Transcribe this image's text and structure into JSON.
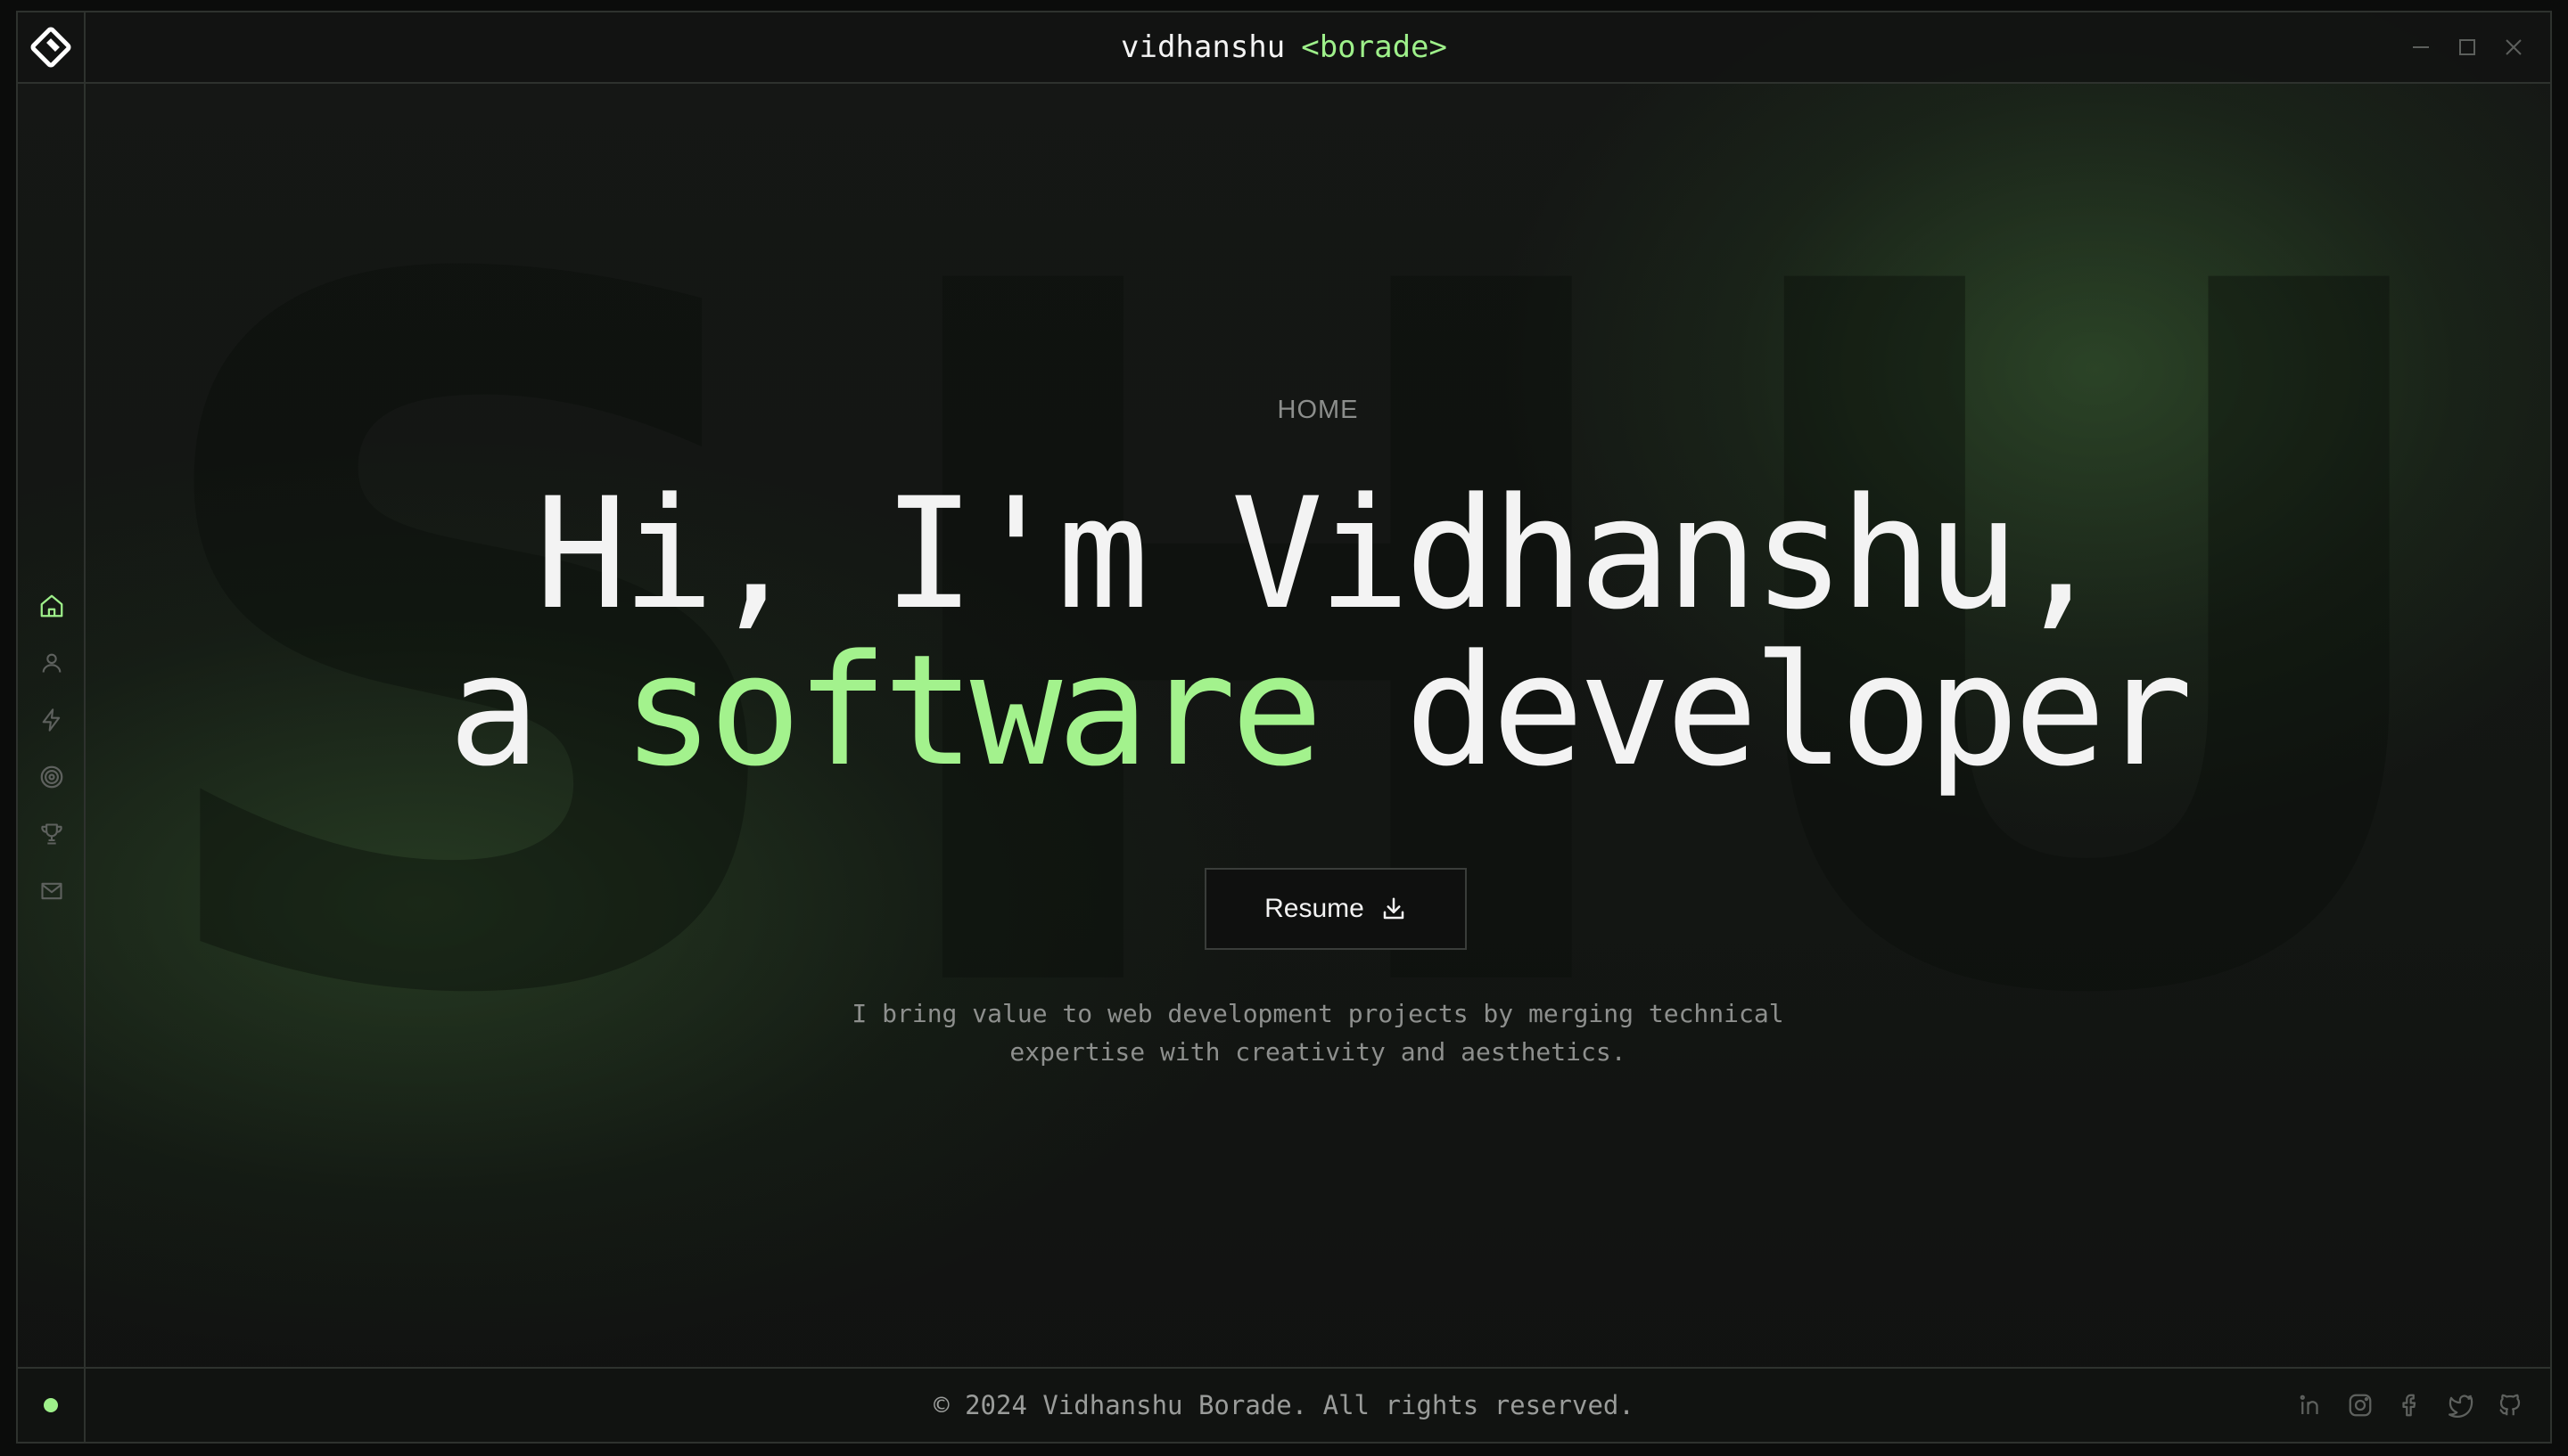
{
  "brand": {
    "first": "vidhanshu",
    "last": "<borade>"
  },
  "icons": {
    "logo": "vb-monogram-logo-icon",
    "window_controls": [
      "minimize-icon",
      "maximize-icon",
      "close-icon"
    ],
    "nav": [
      "home-icon",
      "user-icon",
      "lightning-icon",
      "target-icon",
      "trophy-icon",
      "mail-icon"
    ],
    "socials": [
      "linkedin-icon",
      "instagram-icon",
      "facebook-icon",
      "twitter-icon",
      "github-icon"
    ],
    "resume": "download-icon"
  },
  "sidebar": {
    "active_item": "home"
  },
  "background_word": "SHU",
  "hero": {
    "section_label": "HOME",
    "headline_line1": "Hi, I'm Vidhanshu,",
    "headline_prefix": "a",
    "headline_accent": "software",
    "headline_suffix": "developer",
    "resume_label": "Resume",
    "tagline_line1": "I bring value to web development projects by merging technical",
    "tagline_line2": "expertise with creativity and aesthetics."
  },
  "footer": {
    "copyright": "© 2024 Vidhanshu Borade. All rights reserved."
  },
  "colors": {
    "accent": "#9ef08a",
    "background": "#121312",
    "border": "#2e322e",
    "muted_text": "#8d8f8d"
  }
}
